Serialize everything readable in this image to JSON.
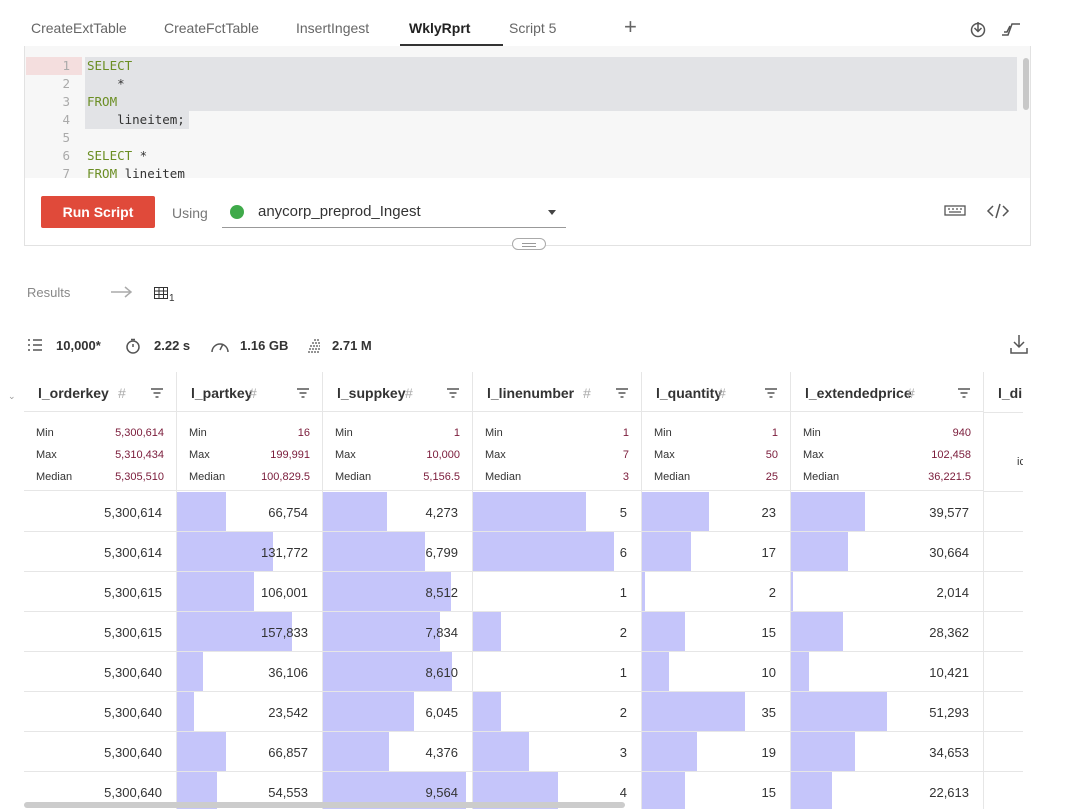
{
  "tabs": [
    {
      "label": "CreateExtTable"
    },
    {
      "label": "CreateFctTable"
    },
    {
      "label": "InsertIngest"
    },
    {
      "label": "WklyRprt",
      "active": true
    },
    {
      "label": "Script 5"
    }
  ],
  "tab_add_label": "+",
  "editor": {
    "lines": [
      {
        "num": "1",
        "kw": "SELECT",
        "rest": ""
      },
      {
        "num": "2",
        "kw": "",
        "rest": "    *"
      },
      {
        "num": "3",
        "kw": "FROM",
        "rest": ""
      },
      {
        "num": "4",
        "kw": "",
        "rest": "    lineitem;"
      },
      {
        "num": "5",
        "kw": "",
        "rest": ""
      },
      {
        "num": "6",
        "kw": "SELECT",
        "rest": " *"
      },
      {
        "num": "7",
        "kw": "FROM",
        "rest": " lineitem"
      }
    ]
  },
  "toolbar": {
    "run_label": "Run Script",
    "using_label": "Using",
    "connection_name": "anycorp_preprod_Ingest",
    "connection_status_color": "#3faa4a",
    "run_color": "#e04a3a"
  },
  "results": {
    "label": "Results",
    "grid_count": "1",
    "rows": "10,000*",
    "duration": "2.22 s",
    "data_size": "1.16 GB",
    "rows_scanned": "2.71 M"
  },
  "table": {
    "bar_color": "#c5c5fa",
    "columns": [
      {
        "name": "l_orderkey",
        "min": "5,300,614",
        "max": "5,310,434",
        "median": "5,305,510",
        "cells": [
          "5,300,614",
          "5,300,614",
          "5,300,615",
          "5,300,615",
          "5,300,640",
          "5,300,640",
          "5,300,640",
          "5,300,640"
        ],
        "fractions": [
          0,
          0,
          0,
          0,
          0,
          0,
          0,
          0
        ]
      },
      {
        "name": "l_partkey",
        "min": "16",
        "max": "199,991",
        "median": "100,829.5",
        "cells": [
          "66,754",
          "131,772",
          "106,001",
          "157,833",
          "36,106",
          "23,542",
          "66,857",
          "54,553"
        ],
        "fractions": [
          0.334,
          0.659,
          0.53,
          0.789,
          0.18,
          0.118,
          0.334,
          0.273
        ]
      },
      {
        "name": "l_suppkey",
        "min": "1",
        "max": "10,000",
        "median": "5,156.5",
        "cells": [
          "4,273",
          "6,799",
          "8,512",
          "7,834",
          "8,610",
          "6,045",
          "4,376",
          "9,564"
        ],
        "fractions": [
          0.427,
          0.68,
          0.851,
          0.783,
          0.861,
          0.604,
          0.437,
          0.956
        ]
      },
      {
        "name": "l_linenumber",
        "min": "1",
        "max": "7",
        "median": "3",
        "cells": [
          "5",
          "6",
          "1",
          "2",
          "1",
          "2",
          "3",
          "4"
        ],
        "fractions": [
          0.667,
          0.833,
          0,
          0.167,
          0,
          0.167,
          0.333,
          0.5
        ]
      },
      {
        "name": "l_quantity",
        "min": "1",
        "max": "50",
        "median": "25",
        "cells": [
          "23",
          "17",
          "2",
          "15",
          "10",
          "35",
          "19",
          "15"
        ],
        "fractions": [
          0.449,
          0.327,
          0.02,
          0.286,
          0.184,
          0.694,
          0.367,
          0.286
        ]
      },
      {
        "name": "l_extendedprice",
        "min": "940",
        "max": "102,458",
        "median": "36,221.5",
        "cells": [
          "39,577",
          "30,664",
          "2,014",
          "28,362",
          "10,421",
          "51,293",
          "34,653",
          "22,613"
        ],
        "fractions": [
          0.381,
          0.293,
          0.011,
          0.27,
          0.094,
          0.496,
          0.332,
          0.214
        ]
      }
    ],
    "partial_column": {
      "name": "l_di",
      "stat_fragment": "ic"
    },
    "stat_labels": {
      "min": "Min",
      "max": "Max",
      "median": "Median"
    },
    "hash_symbol": "#"
  }
}
